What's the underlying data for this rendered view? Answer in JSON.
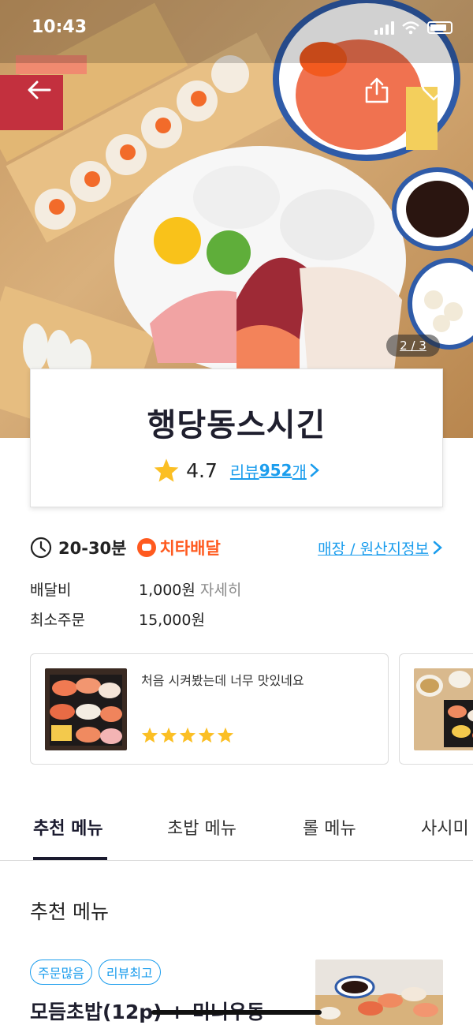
{
  "status_bar": {
    "time": "10:43"
  },
  "hero": {
    "page_indicator": "2 / 3"
  },
  "store": {
    "name": "행당동스시긴",
    "rating": "4.7",
    "review_prefix": "리뷰 ",
    "review_count": "952",
    "review_suffix": "개"
  },
  "delivery": {
    "time": "20-30분",
    "service_name": "치타배달",
    "store_info_link": "매장 / 원산지정보",
    "fee_label": "배달비",
    "fee_value": "1,000원",
    "fee_detail": "자세히",
    "min_order_label": "최소주문",
    "min_order_value": "15,000원"
  },
  "reviews": [
    {
      "text": "처음 시켜봤는데 너무 맛있네요",
      "stars": 5
    }
  ],
  "tabs": [
    "추천 메뉴",
    "초밥 메뉴",
    "롤 메뉴",
    "사시미"
  ],
  "active_tab": 0,
  "section": {
    "title": "추천 메뉴",
    "badges": [
      "주문많음",
      "리뷰최고"
    ],
    "menu_name": "모듬초밥(12p) + 미니우동"
  },
  "colors": {
    "accent": "#1b9ded",
    "star": "#fbbf24",
    "cheetah": "#ff5a1f",
    "dark": "#1f1f2e"
  },
  "icons": {
    "back": "arrow-left-icon",
    "share": "share-icon",
    "favorite": "heart-icon",
    "clock": "clock-icon",
    "star": "star-icon",
    "chevron": "chevron-right-icon"
  }
}
